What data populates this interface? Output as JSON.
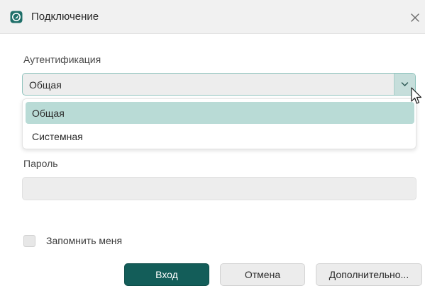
{
  "window": {
    "title": "Подключение"
  },
  "auth": {
    "label": "Аутентификация",
    "selected_value": "Общая",
    "options": [
      "Общая",
      "Системная"
    ]
  },
  "password": {
    "label": "Пароль",
    "value": ""
  },
  "remember": {
    "label": "Запомнить меня",
    "checked": false
  },
  "buttons": {
    "login": "Вход",
    "cancel": "Отмена",
    "advanced": "Дополнительно..."
  },
  "colors": {
    "primary": "#135d59",
    "accent_border": "#8fc3bd",
    "selected_option": "#b9dbd6"
  },
  "icons": {
    "app": "app-logo-icon",
    "close": "close-icon",
    "dropdown": "chevron-down-icon",
    "pointer": "mouse-cursor-icon"
  }
}
